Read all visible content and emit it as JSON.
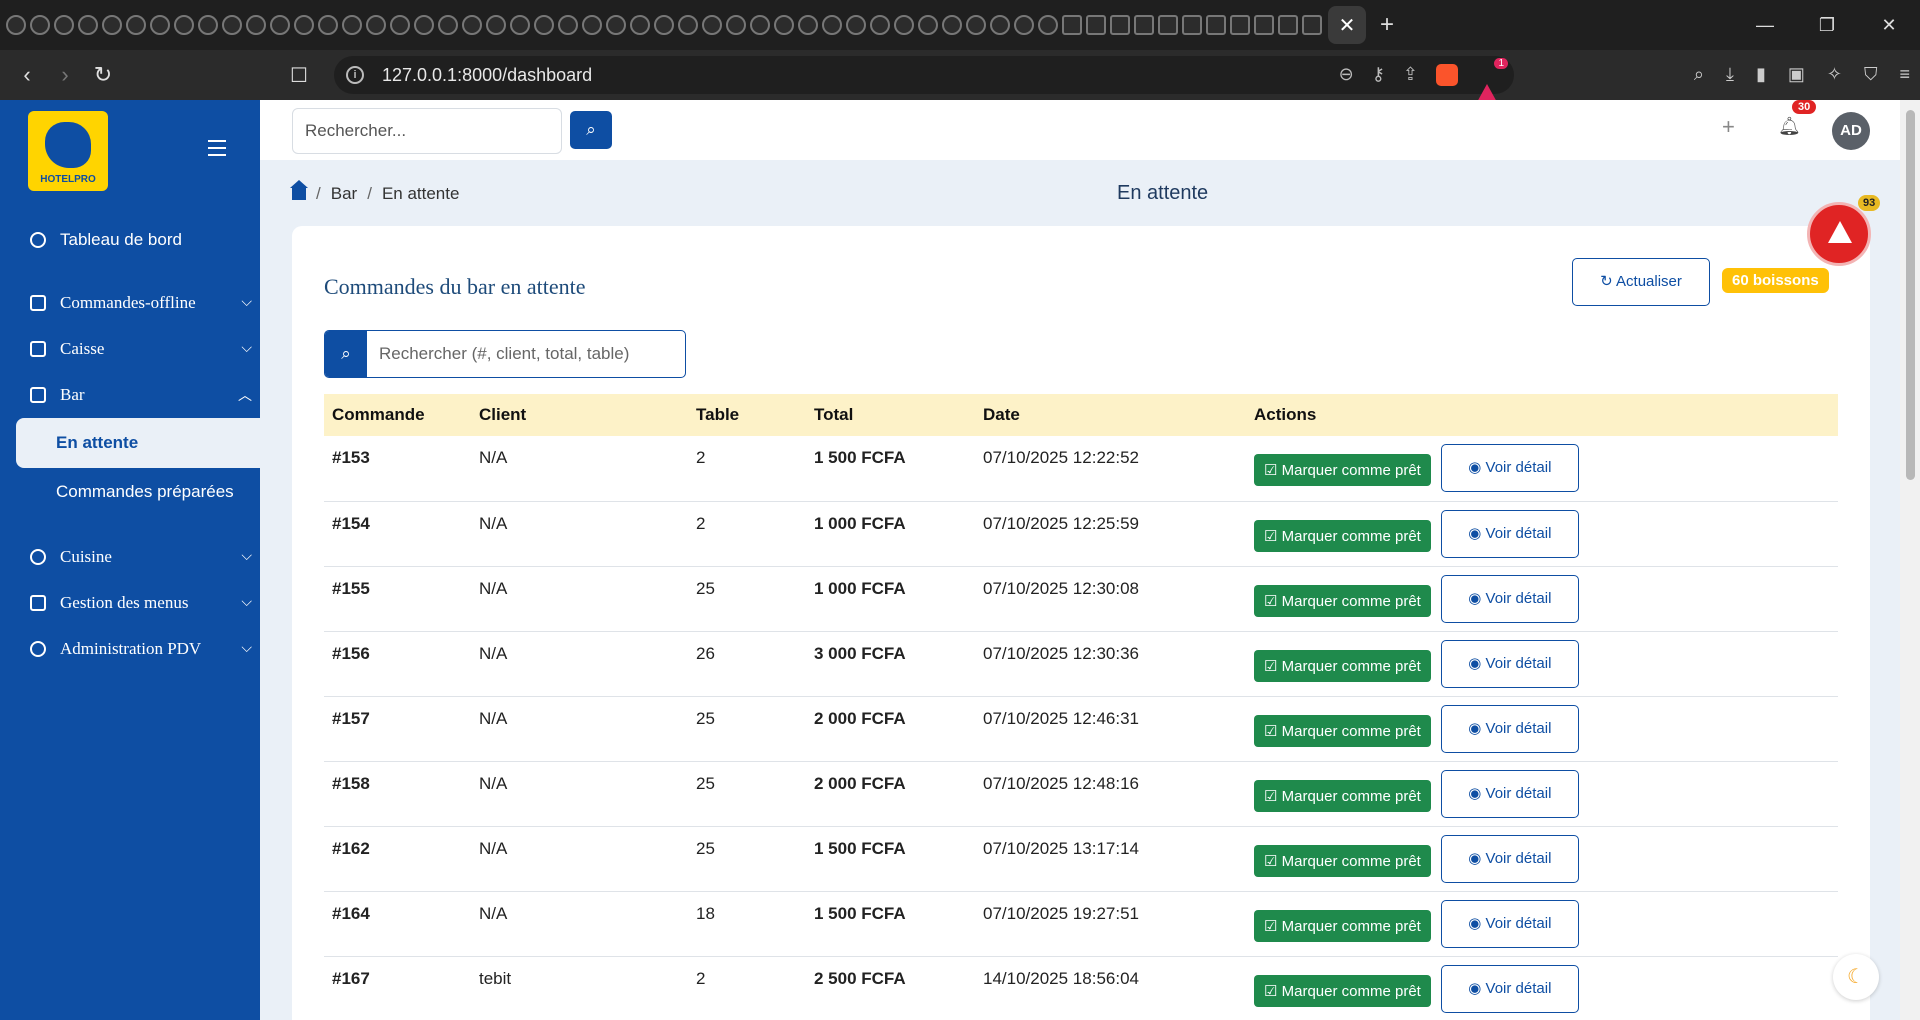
{
  "browser": {
    "url": "127.0.0.1:8000/dashboard",
    "warning_badge": "1"
  },
  "sidebar": {
    "logo_text": "HOTELPRO",
    "items": [
      {
        "label": "Tableau de bord",
        "icon": "gauge-icon"
      },
      {
        "label": "Commandes-offline",
        "icon": "list-icon"
      },
      {
        "label": "Caisse",
        "icon": "cash-icon"
      },
      {
        "label": "Bar",
        "icon": "cup-icon"
      },
      {
        "label": "Cuisine",
        "icon": "cooking-icon"
      },
      {
        "label": "Gestion des menus",
        "icon": "menu-book-icon"
      },
      {
        "label": "Administration PDV",
        "icon": "gear-icon"
      }
    ],
    "bar_sub": [
      "En attente",
      "Commandes préparées"
    ]
  },
  "topbar": {
    "search_placeholder": "Rechercher...",
    "notifications_count": "30",
    "avatar_initials": "AD"
  },
  "breadcrumb": [
    "Bar",
    "En attente"
  ],
  "page_title": "En attente",
  "card": {
    "title": "Commandes du bar en attente",
    "refresh_label": "Actualiser",
    "count_badge": "60 boissons",
    "search_placeholder": "Rechercher (#, client, total, table)"
  },
  "table": {
    "headers": [
      "Commande",
      "Client",
      "Table",
      "Total",
      "Date",
      "Actions"
    ],
    "ready_label": "Marquer comme prêt",
    "detail_label": "Voir détail",
    "rows": [
      {
        "id": "#153",
        "client": "N/A",
        "table": "2",
        "total": "1 500 FCFA",
        "date": "07/10/2025 12:22:52"
      },
      {
        "id": "#154",
        "client": "N/A",
        "table": "2",
        "total": "1 000 FCFA",
        "date": "07/10/2025 12:25:59"
      },
      {
        "id": "#155",
        "client": "N/A",
        "table": "25",
        "total": "1 000 FCFA",
        "date": "07/10/2025 12:30:08"
      },
      {
        "id": "#156",
        "client": "N/A",
        "table": "26",
        "total": "3 000 FCFA",
        "date": "07/10/2025 12:30:36"
      },
      {
        "id": "#157",
        "client": "N/A",
        "table": "25",
        "total": "2 000 FCFA",
        "date": "07/10/2025 12:46:31"
      },
      {
        "id": "#158",
        "client": "N/A",
        "table": "25",
        "total": "2 000 FCFA",
        "date": "07/10/2025 12:48:16"
      },
      {
        "id": "#162",
        "client": "N/A",
        "table": "25",
        "total": "1 500 FCFA",
        "date": "07/10/2025 13:17:14"
      },
      {
        "id": "#164",
        "client": "N/A",
        "table": "18",
        "total": "1 500 FCFA",
        "date": "07/10/2025 19:27:51"
      },
      {
        "id": "#167",
        "client": "tebit",
        "table": "2",
        "total": "2 500 FCFA",
        "date": "14/10/2025 18:56:04"
      }
    ]
  },
  "alert_badge": "93"
}
